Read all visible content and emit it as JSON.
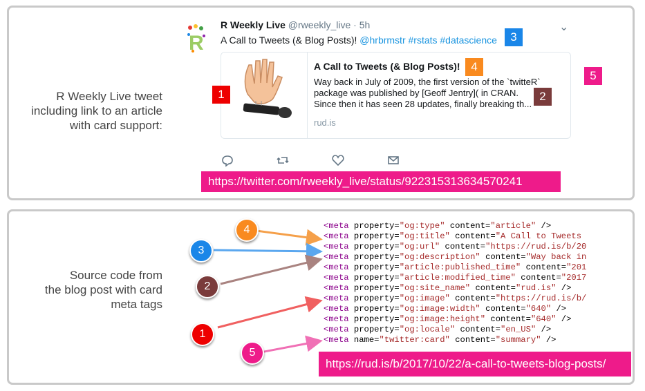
{
  "top_caption": "R Weekly Live tweet\nincluding link to an article\nwith card support:",
  "bottom_caption": "Source code from\nthe blog post with card\nmeta tags",
  "tweet": {
    "name": "R Weekly Live",
    "handle_time": "@rweekly_live · 5h",
    "text": "A Call to Tweets (& Blog Posts)! ",
    "links": "@hrbrmstr #rstats #datascience",
    "card": {
      "title": "A Call to Tweets (& Blog Posts)!",
      "desc_lines": [
        "Way back in July of 2009, the first version of the `twitteR`",
        "package was published by [Geoff Jentry]( in CRAN.",
        "Since then it has seen 28 updates, finally breaking th..."
      ],
      "domain": "rud.is"
    }
  },
  "tweet_url": "https://twitter.com/rweekly_live/status/922315313634570241",
  "post_url": "https://rud.is/b/2017/10/22/a-call-to-tweets-blog-posts/",
  "markers": {
    "m1": "1",
    "m2": "2",
    "m3": "3",
    "m4": "4",
    "m5": "5"
  },
  "marker_colors": {
    "m1": "#ee0000",
    "m2": "#7a3b3b",
    "m3": "#1a86e8",
    "m4": "#f98a1f",
    "m5": "#ee1b8a"
  },
  "code_lines": [
    {
      "tag": "<meta",
      "attr": " property=",
      "prop": "\"og:type\"",
      "attr2": " content=",
      "val": "\"article\"",
      "end": " />"
    },
    {
      "tag": "<meta",
      "attr": " property=",
      "prop": "\"og:title\"",
      "attr2": " content=",
      "val": "\"A Call to Tweets",
      "end": ""
    },
    {
      "tag": "<meta",
      "attr": " property=",
      "prop": "\"og:url\"",
      "attr2": " content=",
      "val": "\"https://rud.is/b/20",
      "end": ""
    },
    {
      "tag": "<meta",
      "attr": " property=",
      "prop": "\"og:description\"",
      "attr2": " content=",
      "val": "\"Way back in",
      "end": ""
    },
    {
      "tag": "<meta",
      "attr": " property=",
      "prop": "\"article:published_time\"",
      "attr2": " content=",
      "val": "\"201",
      "end": ""
    },
    {
      "tag": "<meta",
      "attr": " property=",
      "prop": "\"article:modified_time\"",
      "attr2": " content=",
      "val": "\"2017",
      "end": ""
    },
    {
      "tag": "<meta",
      "attr": " property=",
      "prop": "\"og:site_name\"",
      "attr2": " content=",
      "val": "\"rud.is\"",
      "end": " />"
    },
    {
      "tag": "<meta",
      "attr": " property=",
      "prop": "\"og:image\"",
      "attr2": " content=",
      "val": "\"https://rud.is/b/",
      "end": ""
    },
    {
      "tag": "<meta",
      "attr": " property=",
      "prop": "\"og:image:width\"",
      "attr2": " content=",
      "val": "\"640\"",
      "end": " />"
    },
    {
      "tag": "<meta",
      "attr": " property=",
      "prop": "\"og:image:height\"",
      "attr2": " content=",
      "val": "\"640\"",
      "end": " />"
    },
    {
      "tag": "<meta",
      "attr": " property=",
      "prop": "\"og:locale\"",
      "attr2": " content=",
      "val": "\"en_US\"",
      "end": " />"
    },
    {
      "tag": "<meta",
      "attr": " name=",
      "prop": "\"twitter:card\"",
      "attr2": " content=",
      "val": "\"summary\"",
      "end": " />"
    }
  ]
}
